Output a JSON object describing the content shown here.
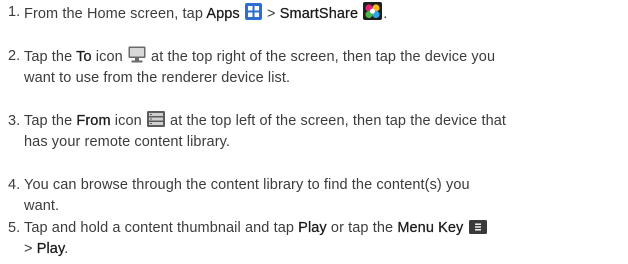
{
  "steps": [
    {
      "number": "1.",
      "parts": {
        "t1": "From the Home screen, tap ",
        "b1": "Apps",
        "t2": " > ",
        "b2": "SmartShare",
        "t3": "."
      },
      "icons": [
        "apps-grid-icon",
        "smartshare-icon"
      ]
    },
    {
      "number": "2.",
      "parts": {
        "t1": "Tap the ",
        "b1": "To",
        "t2": " icon ",
        "t3": " at the top right of the screen, then tap the device you",
        "t4": "want to use from the renderer device list."
      },
      "icons": [
        "monitor-icon"
      ]
    },
    {
      "number": "3.",
      "parts": {
        "t1": "Tap the ",
        "b1": "From",
        "t2": " icon ",
        "t3": " at the top left of the screen, then tap the device that",
        "t4": "has your remote content library."
      },
      "icons": [
        "server-icon"
      ]
    },
    {
      "number": "4.",
      "parts": {
        "t1": "You can browse through the content library to find the content(s) you",
        "t2": "want."
      }
    },
    {
      "number": "5.",
      "parts": {
        "t1": "Tap and hold a content thumbnail and tap ",
        "b1": "Play",
        "t2": " or tap the ",
        "b2": "Menu Key",
        "t3": "> ",
        "b3": "Play",
        "t4": "."
      },
      "icons": [
        "menu-key-icon"
      ]
    }
  ],
  "colors": {
    "text": "#3c3c3c",
    "bold_text": "#1a1a1a",
    "apps_icon_bg": "#2b6fd0",
    "smartshare_pink": "#e2207a",
    "monitor_icon": "#6a6a6a",
    "menu_key_icon": "#3a3a3a"
  }
}
